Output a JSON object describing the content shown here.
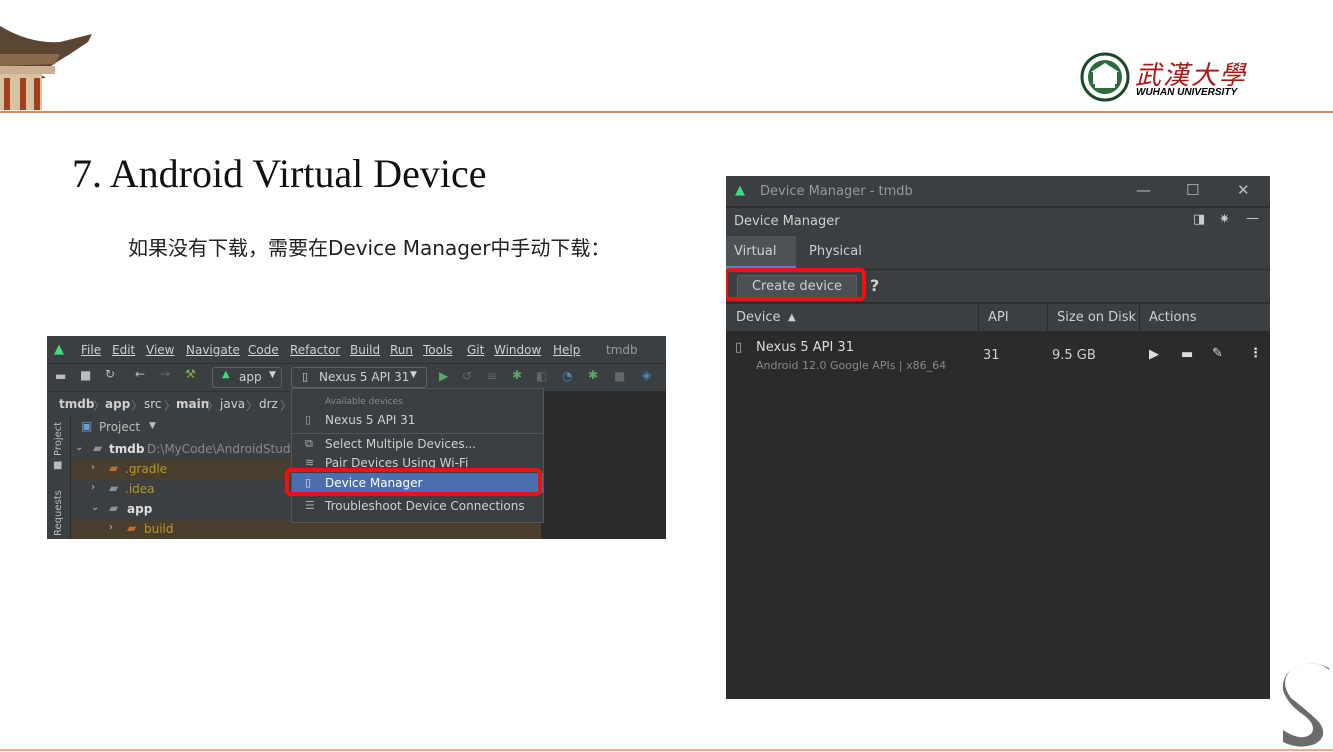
{
  "slide": {
    "title": "7. Android Virtual Device",
    "text": "如果没有下载，需要在Device Manager中手动下载：",
    "university_cn": "武漢大學",
    "university_en": "WUHAN UNIVERSITY"
  },
  "ide": {
    "menu": [
      "File",
      "Edit",
      "View",
      "Navigate",
      "Code",
      "Refactor",
      "Build",
      "Run",
      "Tools",
      "Git",
      "Window",
      "Help"
    ],
    "project_name": "tmdb",
    "run_config": "app",
    "device_selector": "Nexus 5 API 31",
    "breadcrumb": [
      "tmdb",
      "app",
      "src",
      "main",
      "java",
      "drz"
    ],
    "side_tabs": {
      "project": "Project",
      "requests": "Requests"
    },
    "project_panel_label": "Project",
    "tree": {
      "root": "tmdb",
      "root_path": "D:\\MyCode\\AndroidStudi",
      "gradle": ".gradle",
      "idea": ".idea",
      "app": "app",
      "build": "build"
    },
    "dropdown": {
      "header": "Available devices",
      "device": "Nexus 5 API 31",
      "select_multiple": "Select Multiple Devices...",
      "pair_devices": "Pair Devices Using Wi-Fi",
      "device_manager": "Device Manager",
      "troubleshoot": "Troubleshoot Device Connections"
    },
    "highlight_color": "#e11111"
  },
  "device_manager": {
    "window_title": "Device Manager - tmdb",
    "panel_title": "Device Manager",
    "tabs": [
      "Virtual",
      "Physical"
    ],
    "create_button": "Create device",
    "help": "?",
    "columns": {
      "device": "Device",
      "api": "API",
      "size": "Size on Disk",
      "actions": "Actions"
    },
    "sort_indicator": "▲",
    "devices": [
      {
        "name": "Nexus 5 API 31",
        "details": "Android 12.0 Google APIs | x86_64",
        "api": "31",
        "size": "9.5 GB"
      }
    ],
    "window_controls": {
      "minimize": "—",
      "maximize": "☐",
      "close": "✕"
    }
  }
}
